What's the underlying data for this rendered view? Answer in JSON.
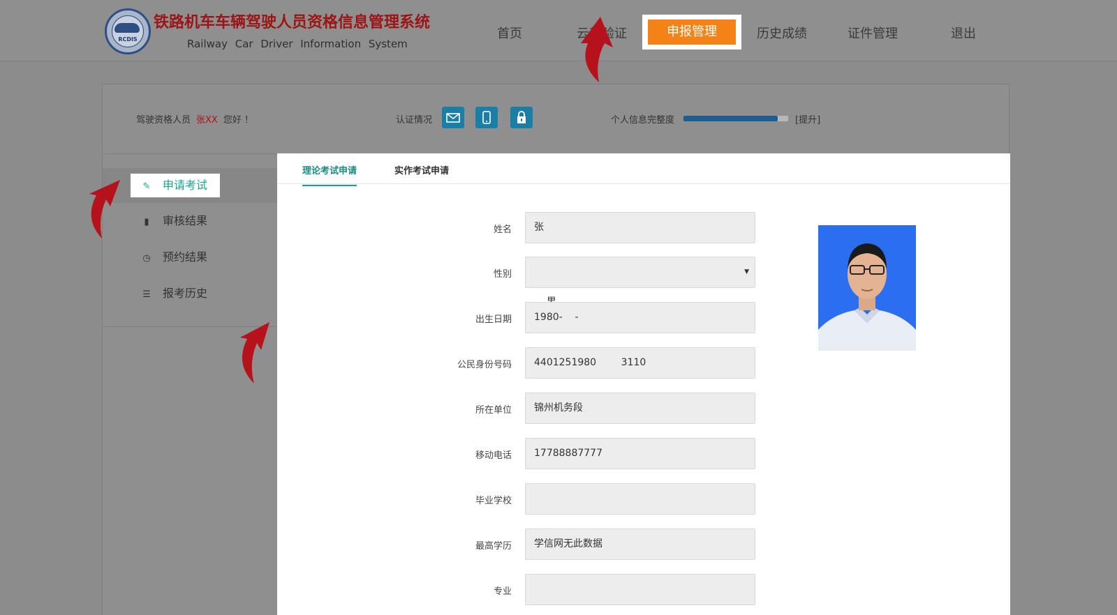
{
  "header": {
    "logo_text": "RCDIS",
    "title_cn": "铁路机车车辆驾驶人员资格信息管理系统",
    "title_en": "Railway Car Driver Information System",
    "nav": [
      {
        "label": "首页"
      },
      {
        "label": "云驾验证"
      },
      {
        "label": "申报管理",
        "active": true
      },
      {
        "label": "历史成绩"
      },
      {
        "label": "证件管理"
      },
      {
        "label": "退出"
      }
    ]
  },
  "userbar": {
    "greet_prefix": "驾驶资格人员",
    "user_name": "张XX",
    "greet_suffix": "您好 ！",
    "auth_label": "认证情况",
    "auth_icons": [
      "mail-icon",
      "phone-icon",
      "lock-icon"
    ],
    "progress_label": "个人信息完整度",
    "progress_value": 0.9,
    "progress_link": "[提升]"
  },
  "sidebar": {
    "items": [
      {
        "label": "申请考试",
        "icon": "edit-icon",
        "active": true
      },
      {
        "label": "审核结果",
        "icon": "file-icon"
      },
      {
        "label": "预约结果",
        "icon": "clock-icon"
      },
      {
        "label": "报考历史",
        "icon": "list-icon"
      }
    ]
  },
  "tabs": [
    {
      "label": "理论考试申请",
      "active": true
    },
    {
      "label": "实作考试申请"
    }
  ],
  "form": {
    "name": {
      "label": "姓名",
      "value": "张"
    },
    "gender": {
      "label": "性别",
      "value": "男"
    },
    "birth": {
      "label": "出生日期",
      "value": "1980-    -"
    },
    "id_number": {
      "label": "公民身份号码",
      "value": "4401251980        3110"
    },
    "unit": {
      "label": "所在单位",
      "value": "锦州机务段"
    },
    "phone": {
      "label": "移动电话",
      "value": "17788887777"
    },
    "school": {
      "label": "毕业学校",
      "value": ""
    },
    "education": {
      "label": "最高学历",
      "value": "学信网无此数据"
    },
    "major": {
      "label": "专业",
      "value": ""
    }
  },
  "colors": {
    "accent": "#f58216",
    "tab_active": "#1a9d8f",
    "auth_button": "#1a7fa6",
    "annotation_arrow": "#b5121b"
  }
}
